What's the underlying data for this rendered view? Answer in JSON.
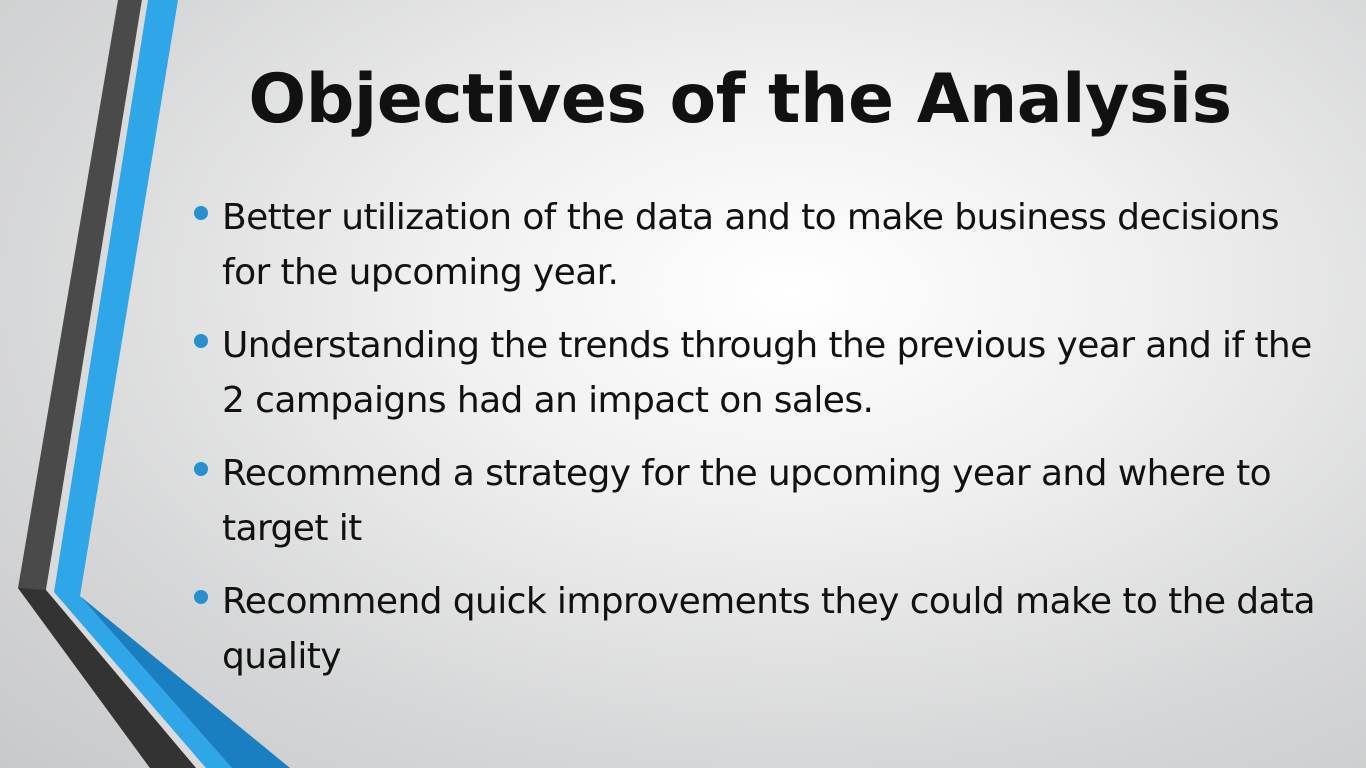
{
  "slide": {
    "title": "Objectives of the Analysis",
    "bullets": [
      "Better utilization of the data and to make business decisions for the upcoming year.",
      " Understanding the trends through the previous year and if the 2 campaigns had an impact on sales.",
      "Recommend a strategy for the upcoming year and where to target it",
      "Recommend quick improvements they could make to the data quality"
    ]
  },
  "colors": {
    "accent_blue": "#2ea6e8",
    "dark_stripe": "#4a4a4a",
    "bullet": "#2a8fd0",
    "text": "#111111"
  }
}
